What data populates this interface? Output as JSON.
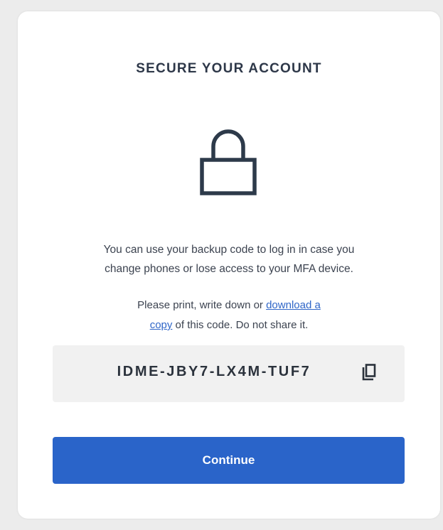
{
  "header": {
    "title": "SECURE YOUR ACCOUNT"
  },
  "icons": {
    "lock": "lock-icon",
    "copy": "copy-icon"
  },
  "description": {
    "line1": "You can use your backup code to log in in case you",
    "line2": "change phones or lose access to your MFA device."
  },
  "note": {
    "prefix": "Please print, write down or ",
    "link_part1": "download a",
    "link_part2": "copy",
    "suffix": " of this code. Do not share it."
  },
  "backup_code": {
    "value": "IDME-JBY7-LX4M-TUF7"
  },
  "actions": {
    "continue_label": "Continue"
  },
  "colors": {
    "accent": "#2a64c9",
    "link": "#2f66c8",
    "code_background": "#f1f1f1",
    "page_background": "#ececec",
    "card_background": "#ffffff",
    "icon": "#2d3a4a"
  }
}
